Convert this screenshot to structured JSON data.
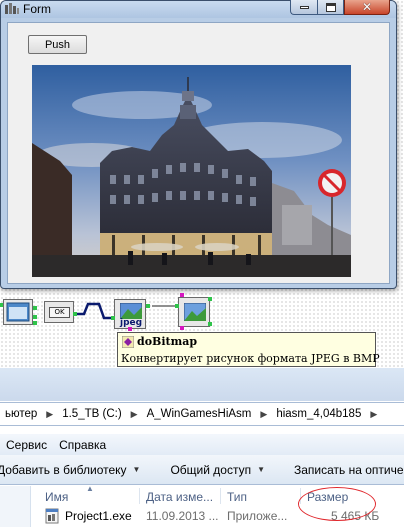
{
  "form": {
    "title": "Form",
    "close_glyph": "✕",
    "push_label": "Push",
    "photo_alt": "Photo of a historic department store building in Oslo at dusk"
  },
  "schema": {
    "element_button_label": "OK",
    "element_jpeg_label": "jpeg",
    "hint_title": "doBitmap",
    "hint_description": "Конвертирует рисунок формата JPEG в BMP"
  },
  "explorer": {
    "breadcrumbs": [
      "ьютер",
      "1.5_TB (C:)",
      "A_WinGamesHiAsm",
      "hiasm_4,04b185"
    ],
    "menu": [
      "Сервис",
      "Справка"
    ],
    "commands": [
      "Добавить в библиотеку",
      "Общий доступ",
      "Записать на оптиче"
    ],
    "columns": [
      "Имя",
      "Дата изме...",
      "Тип",
      "Размер"
    ],
    "file": {
      "name": "Project1.exe",
      "date": "11.09.2013 ...",
      "type": "Приложе...",
      "size": "5 465 КБ"
    }
  },
  "colors": {
    "highlight_circle": "#e0272c",
    "link_point": "#2fc34a",
    "method_point": "#d617c0",
    "hint_background": "#ffffe1"
  },
  "icons": [
    "app-icon",
    "minimize-icon",
    "maximize-icon",
    "close-icon",
    "form-element-icon",
    "picture-icon",
    "jpeg-converter-icon",
    "hint-element-icon",
    "exe-file-icon",
    "chevron-right-icon",
    "chevron-down-icon",
    "sort-arrow-icon"
  ]
}
